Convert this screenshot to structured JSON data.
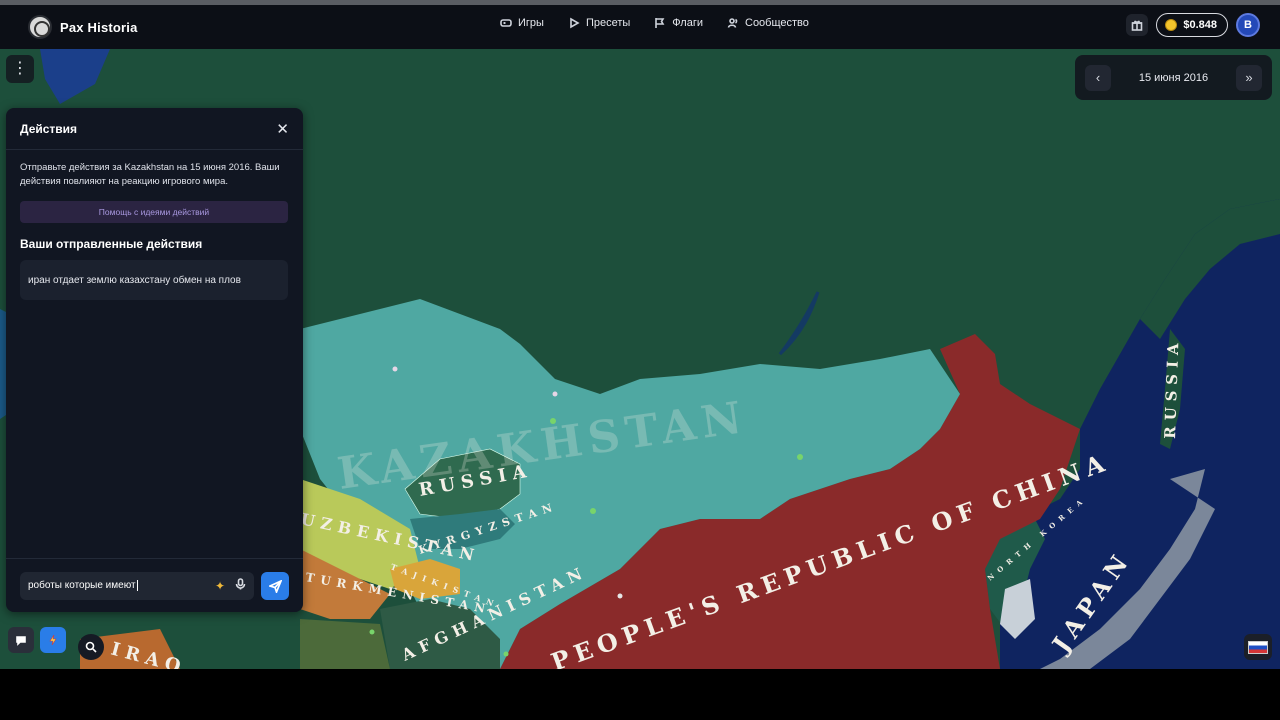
{
  "app": {
    "name": "Pax Historia"
  },
  "nav": {
    "items": [
      {
        "label": "Игры",
        "icon": "gamepad-icon"
      },
      {
        "label": "Пресеты",
        "icon": "play-icon"
      },
      {
        "label": "Флаги",
        "icon": "flag-icon"
      },
      {
        "label": "Сообщество",
        "icon": "users-icon"
      }
    ],
    "balance": "$0.848",
    "avatar_letter": "B"
  },
  "date_panel": {
    "date": "15 июня 2016"
  },
  "actions_panel": {
    "title": "Действия",
    "description": "Отправьте действия за Kazakhstan на 15 июня 2016. Ваши действия повлияют на реакцию игрового мира.",
    "help_button": "Помощь с идеями действий",
    "sent_title": "Ваши отправленные действия",
    "sent_actions": [
      "иран отдает землю казахстану обмен на плов"
    ],
    "input_value": "роботы которые имеют"
  },
  "map": {
    "labels": {
      "kazakhstan": "KAZAKHSTAN",
      "russia_enclave": "RUSSIA",
      "russia_east": "RUSSIA",
      "uzbekistan": "UZBEKISTAN",
      "kyrgyzstan": "KYRGYZSTAN",
      "tajikistan": "TAJIKISTAN",
      "turkmenistan": "TURKMENISTAN",
      "afghanistan": "AFGHANISTAN",
      "iraq": "IRAQ",
      "china": "PEOPLE'S REPUBLIC OF CHINA",
      "japan": "JAPAN",
      "north_korea": "NORTH KOREA"
    },
    "colors": {
      "russia": "#1e5a3e",
      "kazakhstan": "#4fa8a2",
      "china": "#8c2a2a",
      "japan_sea": "#10245f",
      "uzbekistan": "#b9c95a",
      "kyrgyzstan": "#2f7b7b",
      "tajikistan": "#d9a53a",
      "turkmenistan": "#c27a3a",
      "mongolia_area": "#5bb9b0"
    }
  }
}
